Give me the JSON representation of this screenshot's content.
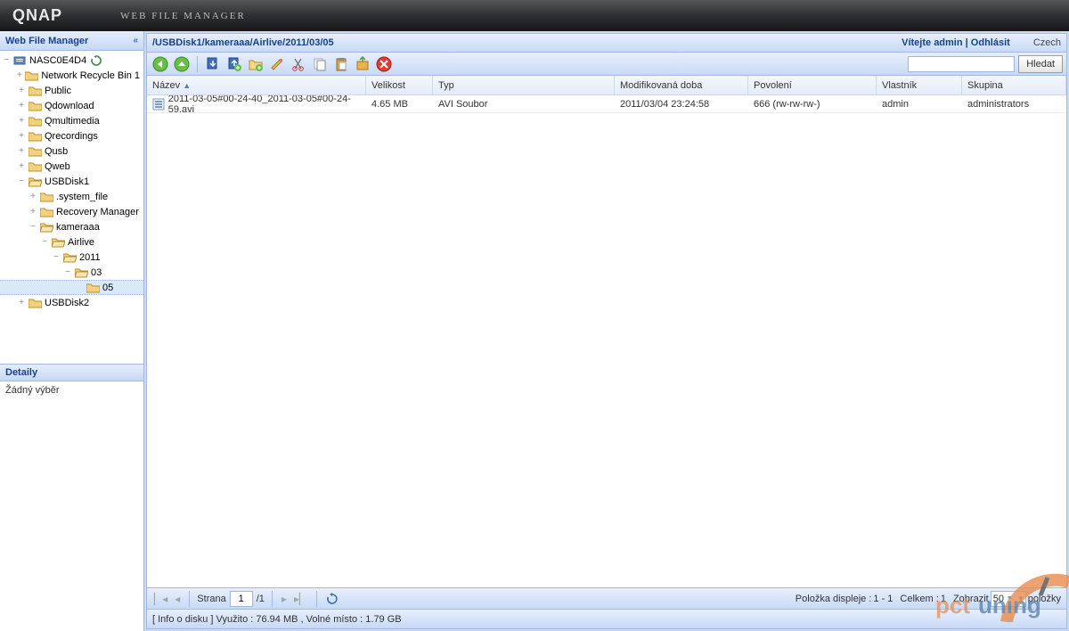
{
  "app": {
    "brand": "QNAP",
    "subtitle": "Web File Manager"
  },
  "sidebar": {
    "title": "Web File Manager",
    "root": "NASC0E4D4",
    "items": [
      {
        "label": "Network Recycle Bin 1",
        "depth": 1,
        "expand": "+"
      },
      {
        "label": "Public",
        "depth": 1,
        "expand": "+"
      },
      {
        "label": "Qdownload",
        "depth": 1,
        "expand": "+"
      },
      {
        "label": "Qmultimedia",
        "depth": 1,
        "expand": "+"
      },
      {
        "label": "Qrecordings",
        "depth": 1,
        "expand": "+"
      },
      {
        "label": "Qusb",
        "depth": 1,
        "expand": "+"
      },
      {
        "label": "Qweb",
        "depth": 1,
        "expand": "+"
      },
      {
        "label": "USBDisk1",
        "depth": 1,
        "expand": "−",
        "open": true
      },
      {
        "label": ".system_file",
        "depth": 2,
        "expand": "+"
      },
      {
        "label": "Recovery Manager",
        "depth": 2,
        "expand": "+"
      },
      {
        "label": "kameraaa",
        "depth": 2,
        "expand": "−",
        "open": true
      },
      {
        "label": "Airlive",
        "depth": 3,
        "expand": "−",
        "open": true
      },
      {
        "label": "2011",
        "depth": 4,
        "expand": "−",
        "open": true
      },
      {
        "label": "03",
        "depth": 5,
        "expand": "−",
        "open": true
      },
      {
        "label": "05",
        "depth": 6,
        "selected": true
      },
      {
        "label": "USBDisk2",
        "depth": 1,
        "expand": "+"
      }
    ],
    "details_title": "Detaily",
    "details_text": "Žádný výběr"
  },
  "main": {
    "path": "/USBDisk1/kameraaa/Airlive/2011/03/05",
    "welcome_prefix": "Vítejte ",
    "welcome_user": "admin",
    "logout": "Odhlásit",
    "lang": "Czech",
    "search_btn": "Hledat"
  },
  "columns": {
    "name": "Název",
    "size": "Velikost",
    "type": "Typ",
    "modified": "Modifikovaná doba",
    "permission": "Povolení",
    "owner": "Vlastník",
    "group": "Skupina"
  },
  "rows": [
    {
      "name": "2011-03-05#00-24-40_2011-03-05#00-24-59.avi",
      "size": "4.65 MB",
      "type": "AVI Soubor",
      "modified": "2011/03/04 23:24:58",
      "permission": "666 (rw-rw-rw-)",
      "owner": "admin",
      "group": "administrators"
    }
  ],
  "paging": {
    "page_label": "Strana",
    "page": "1",
    "total_pages": "/1",
    "display_label": "Položka displeje :",
    "display_range": "1 - 1",
    "total_label": "Celkem :",
    "total_count": "1",
    "show_label": "Zobrazit",
    "show_count": "50",
    "items_label": "položky"
  },
  "status": "[ Info o disku ] Využito : 76.94 MB , Volné místo : 1.79 GB"
}
